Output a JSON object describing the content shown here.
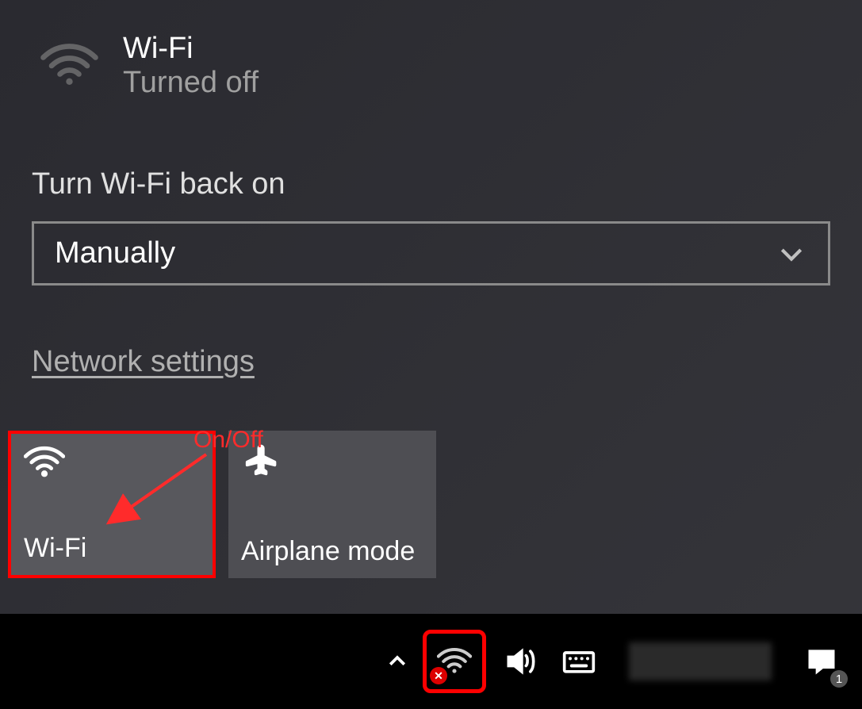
{
  "header": {
    "title": "Wi-Fi",
    "status": "Turned off"
  },
  "turn_back": {
    "label": "Turn Wi-Fi back on",
    "selected": "Manually"
  },
  "links": {
    "network_settings": "Network settings"
  },
  "tiles": {
    "wifi": "Wi-Fi",
    "airplane": "Airplane mode"
  },
  "annotation": {
    "text": "On/Off"
  },
  "taskbar": {
    "notification_count": "1"
  }
}
